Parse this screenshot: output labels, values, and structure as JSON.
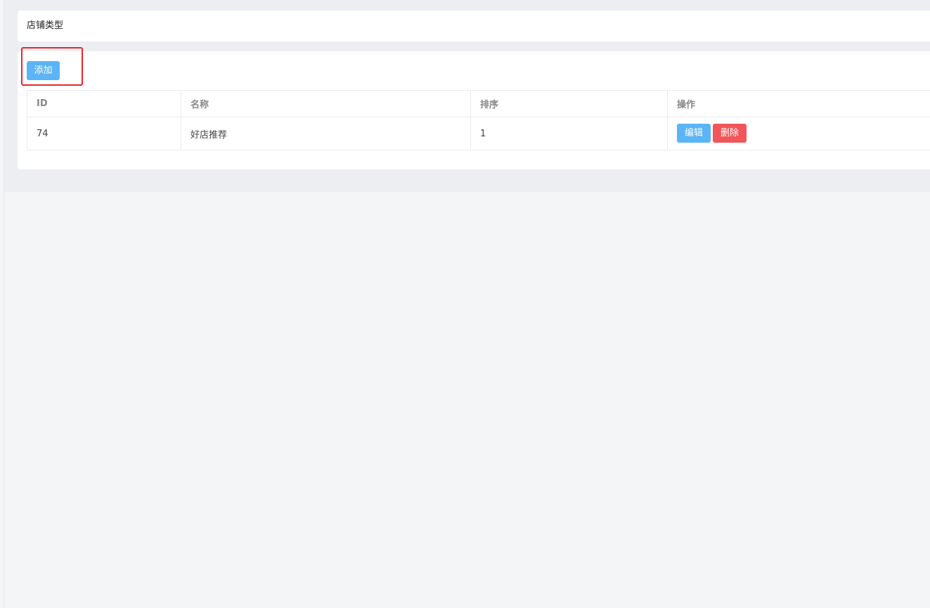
{
  "page": {
    "title": "店铺类型"
  },
  "toolbar": {
    "add_label": "添加"
  },
  "table": {
    "columns": [
      "ID",
      "名称",
      "排序",
      "操作"
    ],
    "rows": [
      {
        "id": "74",
        "name": "好店推荐",
        "sort": "1",
        "actions": {
          "edit": "编辑",
          "delete": "删除"
        }
      }
    ]
  },
  "colors": {
    "primary": "#5bb4f6",
    "danger": "#f0565a",
    "highlight": "#e8262c"
  }
}
